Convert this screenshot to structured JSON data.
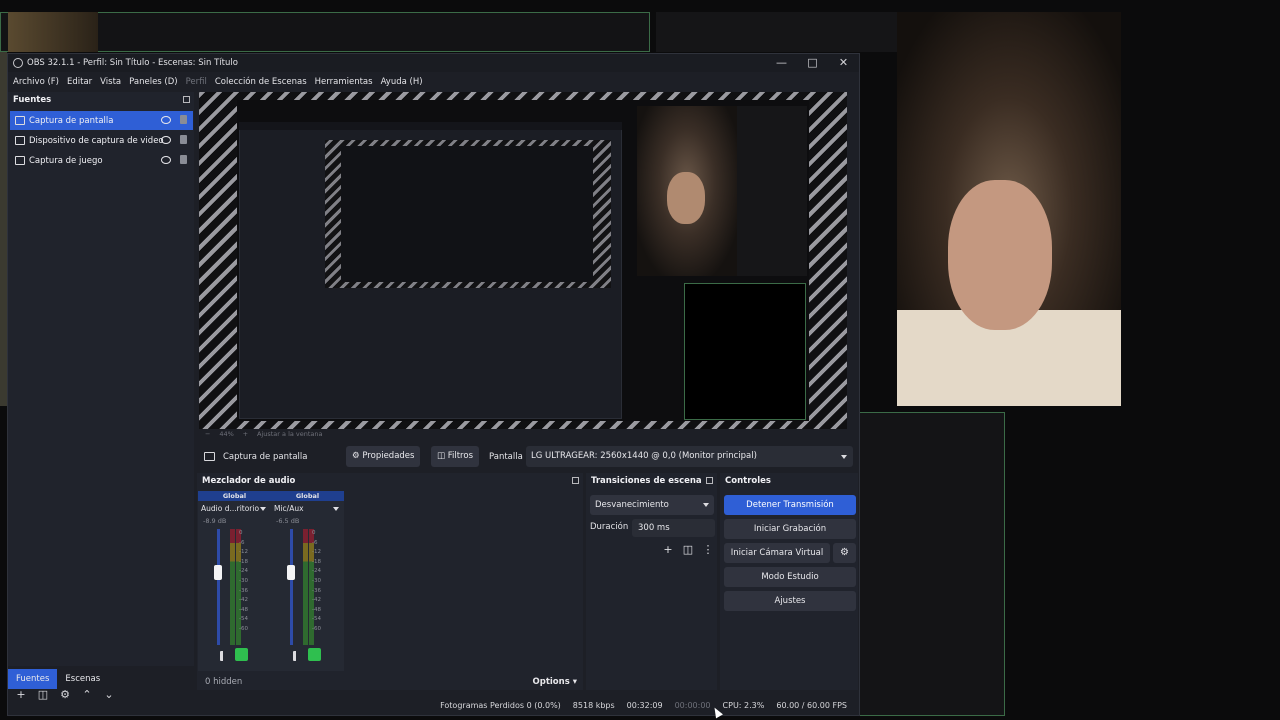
{
  "window": {
    "title": "OBS 32.1.1 - Perfil: Sin Título - Escenas: Sin Título"
  },
  "menu": [
    "Archivo (F)",
    "Editar",
    "Vista",
    "Paneles (D)",
    "Perfil",
    "Colección de Escenas",
    "Herramientas",
    "Ayuda (H)"
  ],
  "sources": {
    "title": "Fuentes",
    "items": [
      {
        "label": "Captura de pantalla",
        "selected": true
      },
      {
        "label": "Dispositivo de captura de video",
        "selected": false
      },
      {
        "label": "Captura de juego",
        "selected": false
      }
    ]
  },
  "bottom_tabs": [
    "Fuentes",
    "Escenas"
  ],
  "context_bar": {
    "source_label": "Captura de pantalla",
    "properties": "Propiedades",
    "filters": "Filtros",
    "display_label": "Pantalla",
    "display_value": "LG ULTRAGEAR: 2560x1440 @ 0,0 (Monitor principal)"
  },
  "mixer": {
    "title": "Mezclador de audio",
    "channels": [
      {
        "group": "Global",
        "name": "Audio d...ritorio",
        "db": "-8.9 dB"
      },
      {
        "group": "Global",
        "name": "Mic/Aux",
        "db": "-6.5 dB"
      }
    ],
    "ticks": [
      "0",
      "-6",
      "-12",
      "-18",
      "-24",
      "-30",
      "-36",
      "-42",
      "-48",
      "-54",
      "-60"
    ],
    "hidden": "0 hidden",
    "options": "Options"
  },
  "transitions": {
    "title": "Transiciones de escena",
    "selected": "Desvanecimiento",
    "duration_label": "Duración",
    "duration_value": "300 ms"
  },
  "controls": {
    "title": "Controles",
    "stop_stream": "Detener Transmisión",
    "start_recording": "Iniciar Grabación",
    "start_virtual_cam": "Iniciar Cámara Virtual",
    "studio_mode": "Modo Estudio",
    "settings": "Ajustes"
  },
  "status": {
    "dropped": "Fotogramas Perdidos 0 (0.0%)",
    "bitrate": "8518 kbps",
    "stream_time": "00:32:09",
    "rec_time": "00:00:00",
    "cpu": "CPU: 2.3%",
    "fps": "60.00 / 60.00 FPS"
  },
  "zoom": {
    "percent": "44%",
    "fit": "Ajustar a la ventana"
  },
  "colors": {
    "accent": "#2f5fd6",
    "panel": "#20232c",
    "window": "#1d1f26",
    "green_border": "#3b6b47"
  }
}
